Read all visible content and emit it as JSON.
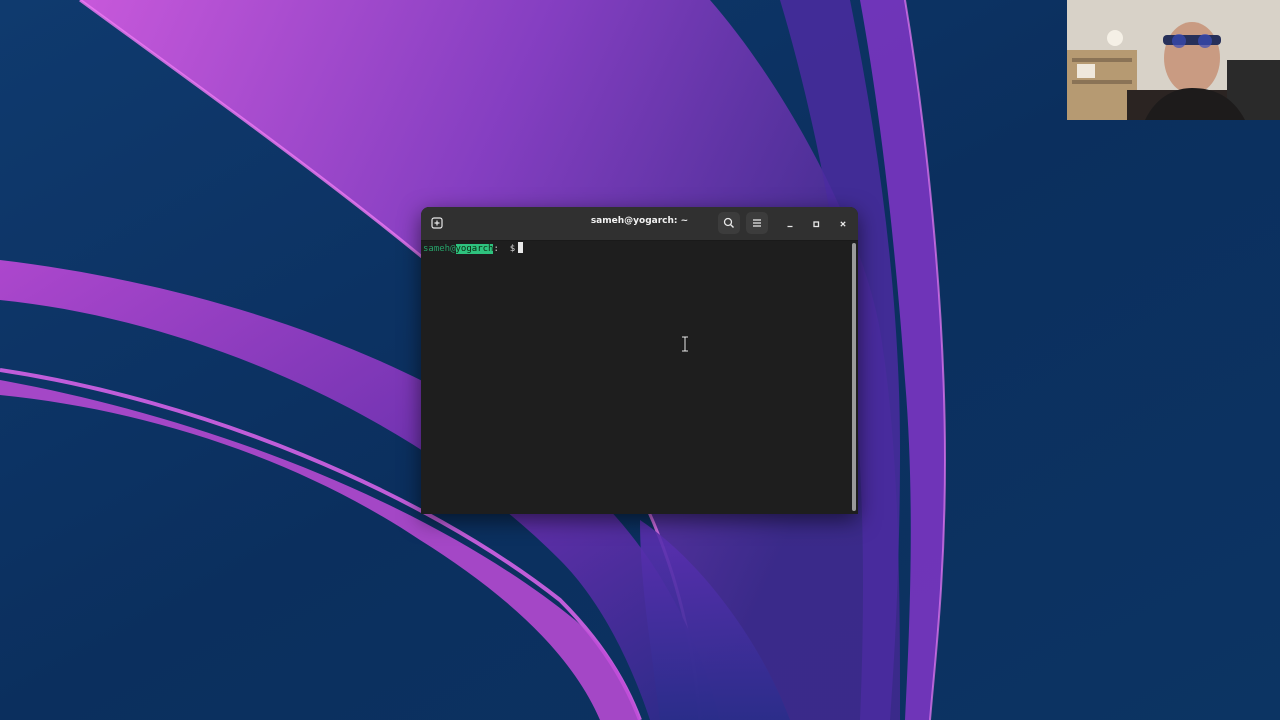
{
  "desktop": {
    "colors": {
      "background": "#0d3566",
      "accent_pink": "#c64ad6",
      "accent_purple": "#5a2aa8"
    }
  },
  "terminal": {
    "title": "sameh@yogarch: ~",
    "prompt": {
      "user": "sameh",
      "at": "@",
      "host": "yogarch",
      "separator": ":",
      "symbol": "$"
    },
    "icons": {
      "new_tab": "new-tab-icon",
      "search": "search-icon",
      "menu": "hamburger-menu-icon",
      "minimize": "minimize-icon",
      "maximize": "maximize-icon",
      "close": "close-icon"
    },
    "colors": {
      "background": "#1e1e1e",
      "headerbar": "#303030",
      "prompt_green": "#26a269",
      "host_highlight": "#2ec27e"
    }
  },
  "webcam": {
    "content": "presenter-video"
  }
}
